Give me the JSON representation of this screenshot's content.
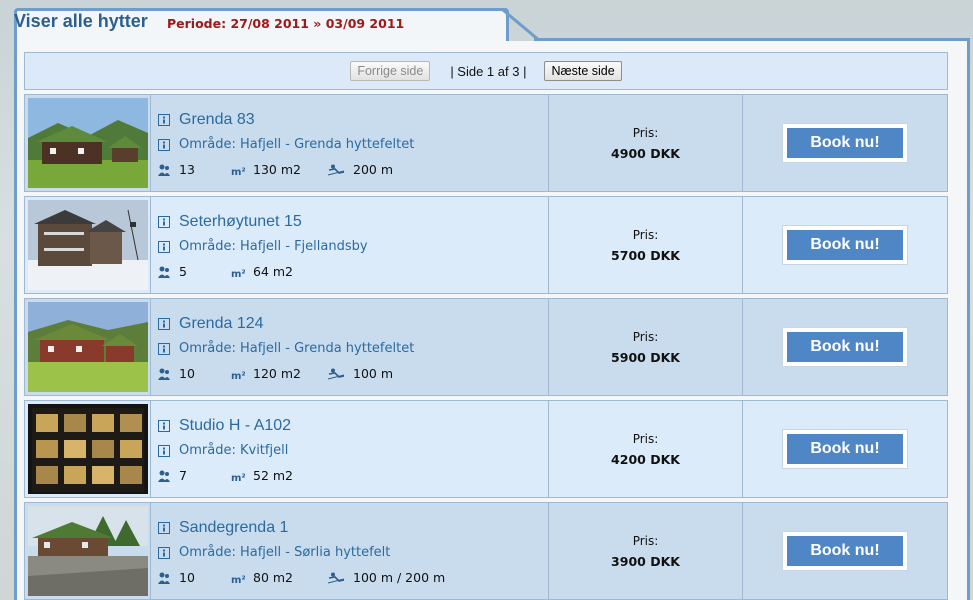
{
  "header": {
    "title": "Viser alle hytter",
    "periode": "Periode: 27/08 2011 » 03/09 2011"
  },
  "pager": {
    "prev_label": "Forrige side",
    "info": "| Side 1 af 3 |",
    "next_label": "Næste side"
  },
  "listings": [
    {
      "name": "Grenda 83",
      "area": "Område: Hafjell - Grenda hyttefeltet",
      "persons": "13",
      "size": "130 m2",
      "distance": "200 m",
      "price_label": "Pris:",
      "price": "4900 DKK",
      "book_label": "Book nu!"
    },
    {
      "name": "Seterhøytunet 15",
      "area": "Område: Hafjell - Fjellandsby",
      "persons": "5",
      "size": "64 m2",
      "distance": "",
      "price_label": "Pris:",
      "price": "5700 DKK",
      "book_label": "Book nu!"
    },
    {
      "name": "Grenda 124",
      "area": "Område: Hafjell - Grenda hyttefeltet",
      "persons": "10",
      "size": "120 m2",
      "distance": "100 m",
      "price_label": "Pris:",
      "price": "5900 DKK",
      "book_label": "Book nu!"
    },
    {
      "name": "Studio H - A102",
      "area": "Område: Kvitfjell",
      "persons": "7",
      "size": "52 m2",
      "distance": "",
      "price_label": "Pris:",
      "price": "4200 DKK",
      "book_label": "Book nu!"
    },
    {
      "name": "Sandegrenda 1",
      "area": "Område: Hafjell - Sørlia hyttefelt",
      "persons": "10",
      "size": "80 m2",
      "distance": "100 m / 200 m",
      "price_label": "Pris:",
      "price": "3900 DKK",
      "book_label": "Book nu!"
    }
  ],
  "icons": {
    "info": "info-icon",
    "persons": "persons-icon",
    "size": "m2-icon",
    "distance": "skier-icon"
  },
  "colors": {
    "frame": "#6f9cca",
    "title": "#2b5f8f",
    "periode": "#a01818",
    "row_dark": "#c9dcee",
    "row_light": "#dcebfa",
    "book_button": "#4f86c6"
  }
}
